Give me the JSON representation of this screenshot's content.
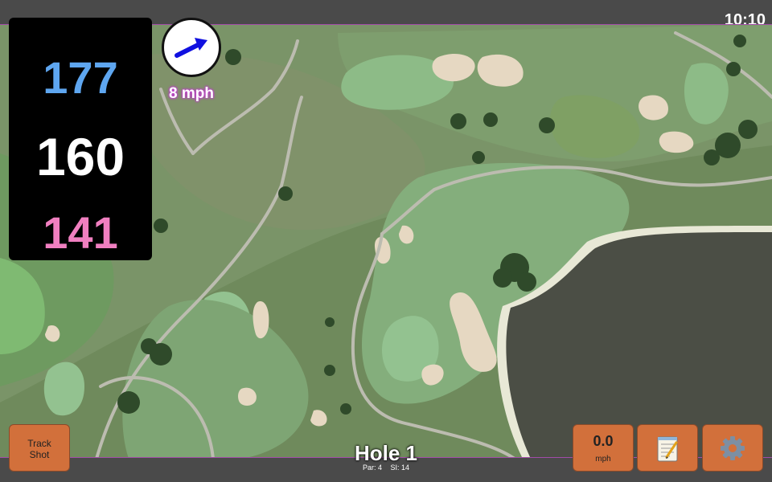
{
  "status_bar": {
    "time": "10:10"
  },
  "distances": {
    "back": "177",
    "middle": "160",
    "front": "141"
  },
  "wind": {
    "speed": "8 mph",
    "icon": "wind-direction-arrow-icon"
  },
  "hole": {
    "title": "Hole 1",
    "par": "Par: 4",
    "stroke_index": "SI: 14"
  },
  "buttons": {
    "track_shot_line1": "Track",
    "track_shot_line2": "Shot",
    "speed_value": "0.0",
    "speed_unit": "mph",
    "notes_icon": "notepad-icon",
    "settings_icon": "gear-icon"
  },
  "colors": {
    "back_distance": "#5ea6f0",
    "middle_distance": "#ffffff",
    "front_distance": "#f07fc0",
    "button": "#d2703b",
    "map_border": "#a24ca8"
  }
}
